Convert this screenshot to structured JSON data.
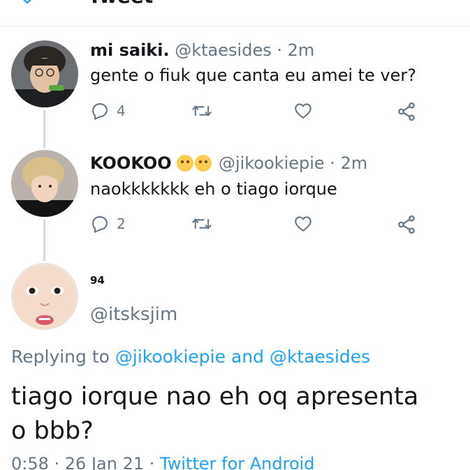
{
  "header": {
    "title": "Tweet"
  },
  "thread": [
    {
      "name": "mi saiki.",
      "handle": "@ktaesides",
      "separator": "·",
      "time": "2m",
      "text": "gente o fiuk que canta eu amei te ver?",
      "reply_count": "4"
    },
    {
      "name": "KOOKOO",
      "emojis": [
        "kissing-face-emoji",
        "raised-eyebrow-face-emoji"
      ],
      "handle": "@jikookiepie",
      "separator": "·",
      "time": "2m",
      "text": "naokkkkkkk eh o tiago iorque",
      "reply_count": "2"
    }
  ],
  "main_tweet": {
    "name": "94",
    "handle": "@itsksjim",
    "replying_prefix": "Replying to",
    "replying_user1": "@jikookiepie",
    "replying_and": "and",
    "replying_user2": "@ktaesides",
    "text_line1": "tiago iorque nao eh oq apresenta",
    "text_line2": "o bbb?",
    "timestamp": "0:58 · 26 Jan 21",
    "separator": "·",
    "source": "Twitter for Android"
  },
  "icons": {
    "reply": "reply-icon",
    "retweet": "retweet-icon",
    "like": "heart-icon",
    "share": "share-icon"
  },
  "colors": {
    "link": "#1da1f2",
    "secondary_text": "#657786",
    "icon": "#657786",
    "thread_line": "#cfd9de"
  }
}
